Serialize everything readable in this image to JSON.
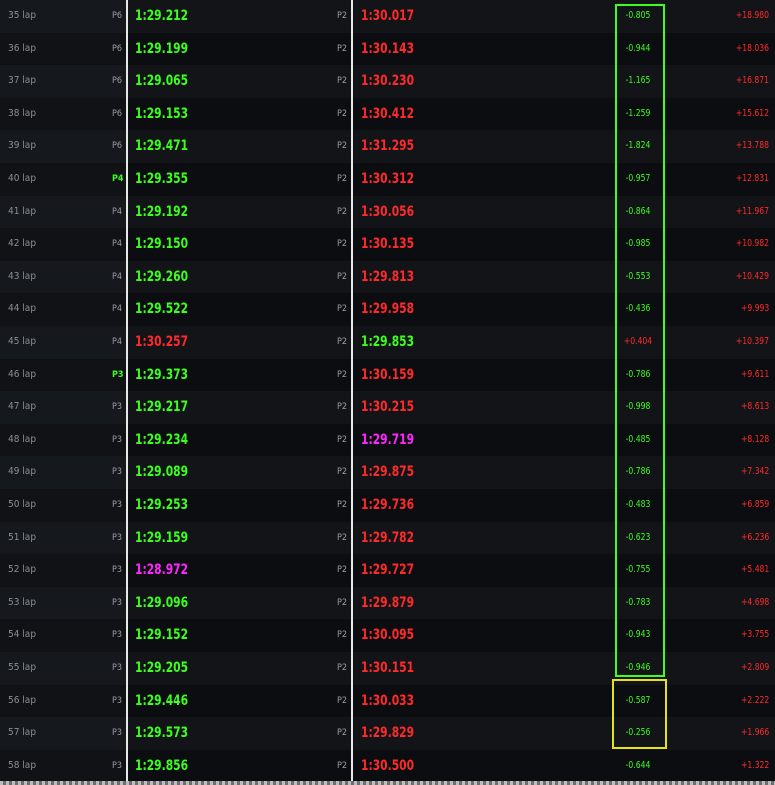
{
  "colors": {
    "green": "#3cff1e",
    "red": "#ff2a2a",
    "magenta": "#ff27ff",
    "box_green": "#3cff1e",
    "box_yellow": "#e6e21a"
  },
  "rows": [
    {
      "lap": "35 lap",
      "posA": "P6",
      "timeA": "1:29.212",
      "colA": "green",
      "posB": "P2",
      "timeB": "1:30.017",
      "colB": "red",
      "gap": "-0.805",
      "gapCol": "green",
      "cum": "+18.980"
    },
    {
      "lap": "36 lap",
      "posA": "P6",
      "timeA": "1:29.199",
      "colA": "green",
      "posB": "P2",
      "timeB": "1:30.143",
      "colB": "red",
      "gap": "-0.944",
      "gapCol": "green",
      "cum": "+18.036"
    },
    {
      "lap": "37 lap",
      "posA": "P6",
      "timeA": "1:29.065",
      "colA": "green",
      "posB": "P2",
      "timeB": "1:30.230",
      "colB": "red",
      "gap": "-1.165",
      "gapCol": "green",
      "cum": "+16.871"
    },
    {
      "lap": "38 lap",
      "posA": "P6",
      "timeA": "1:29.153",
      "colA": "green",
      "posB": "P2",
      "timeB": "1:30.412",
      "colB": "red",
      "gap": "-1.259",
      "gapCol": "green",
      "cum": "+15.612"
    },
    {
      "lap": "39 lap",
      "posA": "P6",
      "timeA": "1:29.471",
      "colA": "green",
      "posB": "P2",
      "timeB": "1:31.295",
      "colB": "red",
      "gap": "-1.824",
      "gapCol": "green",
      "cum": "+13.788"
    },
    {
      "lap": "40 lap",
      "posA": "P4",
      "posAhl": true,
      "timeA": "1:29.355",
      "colA": "green",
      "posB": "P2",
      "timeB": "1:30.312",
      "colB": "red",
      "gap": "-0.957",
      "gapCol": "green",
      "cum": "+12.831"
    },
    {
      "lap": "41 lap",
      "posA": "P4",
      "timeA": "1:29.192",
      "colA": "green",
      "posB": "P2",
      "timeB": "1:30.056",
      "colB": "red",
      "gap": "-0.864",
      "gapCol": "green",
      "cum": "+11.967"
    },
    {
      "lap": "42 lap",
      "posA": "P4",
      "timeA": "1:29.150",
      "colA": "green",
      "posB": "P2",
      "timeB": "1:30.135",
      "colB": "red",
      "gap": "-0.985",
      "gapCol": "green",
      "cum": "+10.982"
    },
    {
      "lap": "43 lap",
      "posA": "P4",
      "timeA": "1:29.260",
      "colA": "green",
      "posB": "P2",
      "timeB": "1:29.813",
      "colB": "red",
      "gap": "-0.553",
      "gapCol": "green",
      "cum": "+10.429"
    },
    {
      "lap": "44 lap",
      "posA": "P4",
      "timeA": "1:29.522",
      "colA": "green",
      "posB": "P2",
      "timeB": "1:29.958",
      "colB": "red",
      "gap": "-0.436",
      "gapCol": "green",
      "cum": "+9.993"
    },
    {
      "lap": "45 lap",
      "posA": "P4",
      "timeA": "1:30.257",
      "colA": "red",
      "posB": "P2",
      "timeB": "1:29.853",
      "colB": "green",
      "gap": "+0.404",
      "gapCol": "red",
      "cum": "+10.397"
    },
    {
      "lap": "46 lap",
      "posA": "P3",
      "posAhl": true,
      "timeA": "1:29.373",
      "colA": "green",
      "posB": "P2",
      "timeB": "1:30.159",
      "colB": "red",
      "gap": "-0.786",
      "gapCol": "green",
      "cum": "+9.611"
    },
    {
      "lap": "47 lap",
      "posA": "P3",
      "timeA": "1:29.217",
      "colA": "green",
      "posB": "P2",
      "timeB": "1:30.215",
      "colB": "red",
      "gap": "-0.998",
      "gapCol": "green",
      "cum": "+8.613"
    },
    {
      "lap": "48 lap",
      "posA": "P3",
      "timeA": "1:29.234",
      "colA": "green",
      "posB": "P2",
      "timeB": "1:29.719",
      "colB": "magenta",
      "gap": "-0.485",
      "gapCol": "green",
      "cum": "+8.128"
    },
    {
      "lap": "49 lap",
      "posA": "P3",
      "timeA": "1:29.089",
      "colA": "green",
      "posB": "P2",
      "timeB": "1:29.875",
      "colB": "red",
      "gap": "-0.786",
      "gapCol": "green",
      "cum": "+7.342"
    },
    {
      "lap": "50 lap",
      "posA": "P3",
      "timeA": "1:29.253",
      "colA": "green",
      "posB": "P2",
      "timeB": "1:29.736",
      "colB": "red",
      "gap": "-0.483",
      "gapCol": "green",
      "cum": "+6.859"
    },
    {
      "lap": "51 lap",
      "posA": "P3",
      "timeA": "1:29.159",
      "colA": "green",
      "posB": "P2",
      "timeB": "1:29.782",
      "colB": "red",
      "gap": "-0.623",
      "gapCol": "green",
      "cum": "+6.236"
    },
    {
      "lap": "52 lap",
      "posA": "P3",
      "timeA": "1:28.972",
      "colA": "magenta",
      "posB": "P2",
      "timeB": "1:29.727",
      "colB": "red",
      "gap": "-0.755",
      "gapCol": "green",
      "cum": "+5.481"
    },
    {
      "lap": "53 lap",
      "posA": "P3",
      "timeA": "1:29.096",
      "colA": "green",
      "posB": "P2",
      "timeB": "1:29.879",
      "colB": "red",
      "gap": "-0.783",
      "gapCol": "green",
      "cum": "+4.698"
    },
    {
      "lap": "54 lap",
      "posA": "P3",
      "timeA": "1:29.152",
      "colA": "green",
      "posB": "P2",
      "timeB": "1:30.095",
      "colB": "red",
      "gap": "-0.943",
      "gapCol": "green",
      "cum": "+3.755"
    },
    {
      "lap": "55 lap",
      "posA": "P3",
      "timeA": "1:29.205",
      "colA": "green",
      "posB": "P2",
      "timeB": "1:30.151",
      "colB": "red",
      "gap": "-0.946",
      "gapCol": "green",
      "cum": "+2.809"
    },
    {
      "lap": "56 lap",
      "posA": "P3",
      "timeA": "1:29.446",
      "colA": "green",
      "posB": "P2",
      "timeB": "1:30.033",
      "colB": "red",
      "gap": "-0.587",
      "gapCol": "green",
      "cum": "+2.222"
    },
    {
      "lap": "57 lap",
      "posA": "P3",
      "timeA": "1:29.573",
      "colA": "green",
      "posB": "P2",
      "timeB": "1:29.829",
      "colB": "red",
      "gap": "-0.256",
      "gapCol": "green",
      "cum": "+1.966"
    },
    {
      "lap": "58 lap",
      "posA": "P3",
      "timeA": "1:29.856",
      "colA": "green",
      "posB": "P2",
      "timeB": "1:30.500",
      "colB": "red",
      "gap": "-0.644",
      "gapCol": "green",
      "cum": "+1.322"
    }
  ]
}
